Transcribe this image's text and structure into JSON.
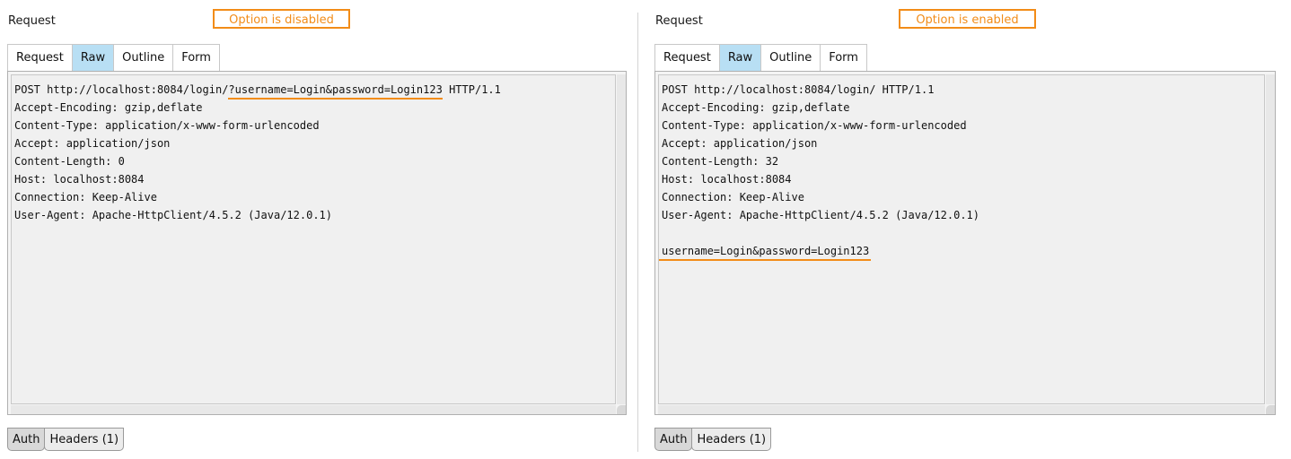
{
  "left": {
    "title": "Request",
    "callout": "Option is disabled",
    "tabs": [
      "Request",
      "Raw",
      "Outline",
      "Form"
    ],
    "active_tab": "Raw",
    "request_line": {
      "before": "POST http://localhost:8084/login/",
      "highlight": "?username=Login&password=Login123",
      "after": " HTTP/1.1"
    },
    "headers": [
      "Accept-Encoding: gzip,deflate",
      "Content-Type: application/x-www-form-urlencoded",
      "Accept: application/json",
      "Content-Length: 0",
      "Host: localhost:8084",
      "Connection: Keep-Alive",
      "User-Agent: Apache-HttpClient/4.5.2 (Java/12.0.1)"
    ],
    "bottom_tabs": [
      "Auth",
      "Headers (1)"
    ]
  },
  "right": {
    "title": "Request",
    "callout": "Option is enabled",
    "tabs": [
      "Request",
      "Raw",
      "Outline",
      "Form"
    ],
    "active_tab": "Raw",
    "request_line": "POST http://localhost:8084/login/ HTTP/1.1",
    "headers": [
      "Accept-Encoding: gzip,deflate",
      "Content-Type: application/x-www-form-urlencoded",
      "Accept: application/json",
      "Content-Length: 32",
      "Host: localhost:8084",
      "Connection: Keep-Alive",
      "User-Agent: Apache-HttpClient/4.5.2 (Java/12.0.1)"
    ],
    "body": "username=Login&password=Login123",
    "bottom_tabs": [
      "Auth",
      "Headers (1)"
    ]
  },
  "colors": {
    "highlight": "#f28c18",
    "active_tab": "#b8dff4"
  }
}
